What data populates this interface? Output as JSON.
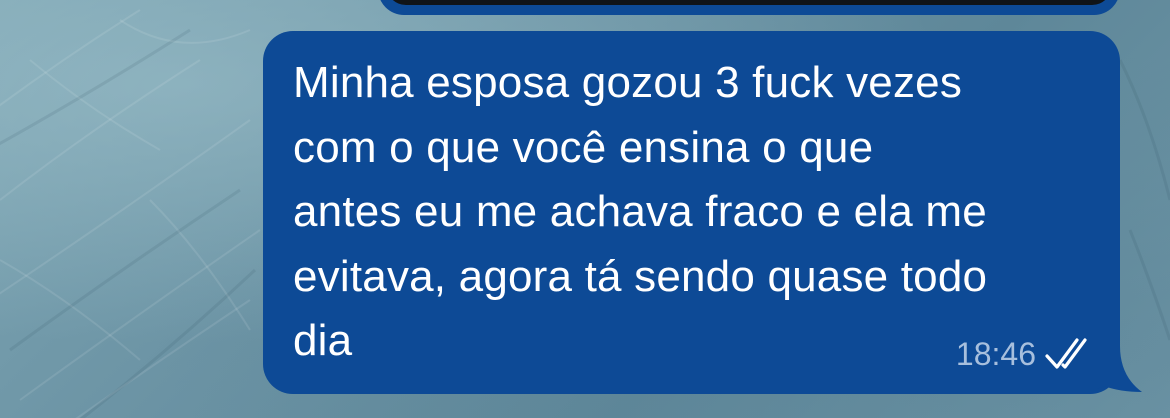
{
  "message": {
    "text": "Minha esposa gozou 3 fuck vezes\ncom o que você ensina o que\nantes eu me achava fraco e ela me\nevitava, agora tá sendo quase todo\ndia",
    "time": "18:46",
    "status_icon": "double-check-read-icon"
  },
  "colors": {
    "bubble": "#0d4a96",
    "text": "#ffffff",
    "timestamp": "#a7bfdd",
    "previous_media": "#101418"
  }
}
